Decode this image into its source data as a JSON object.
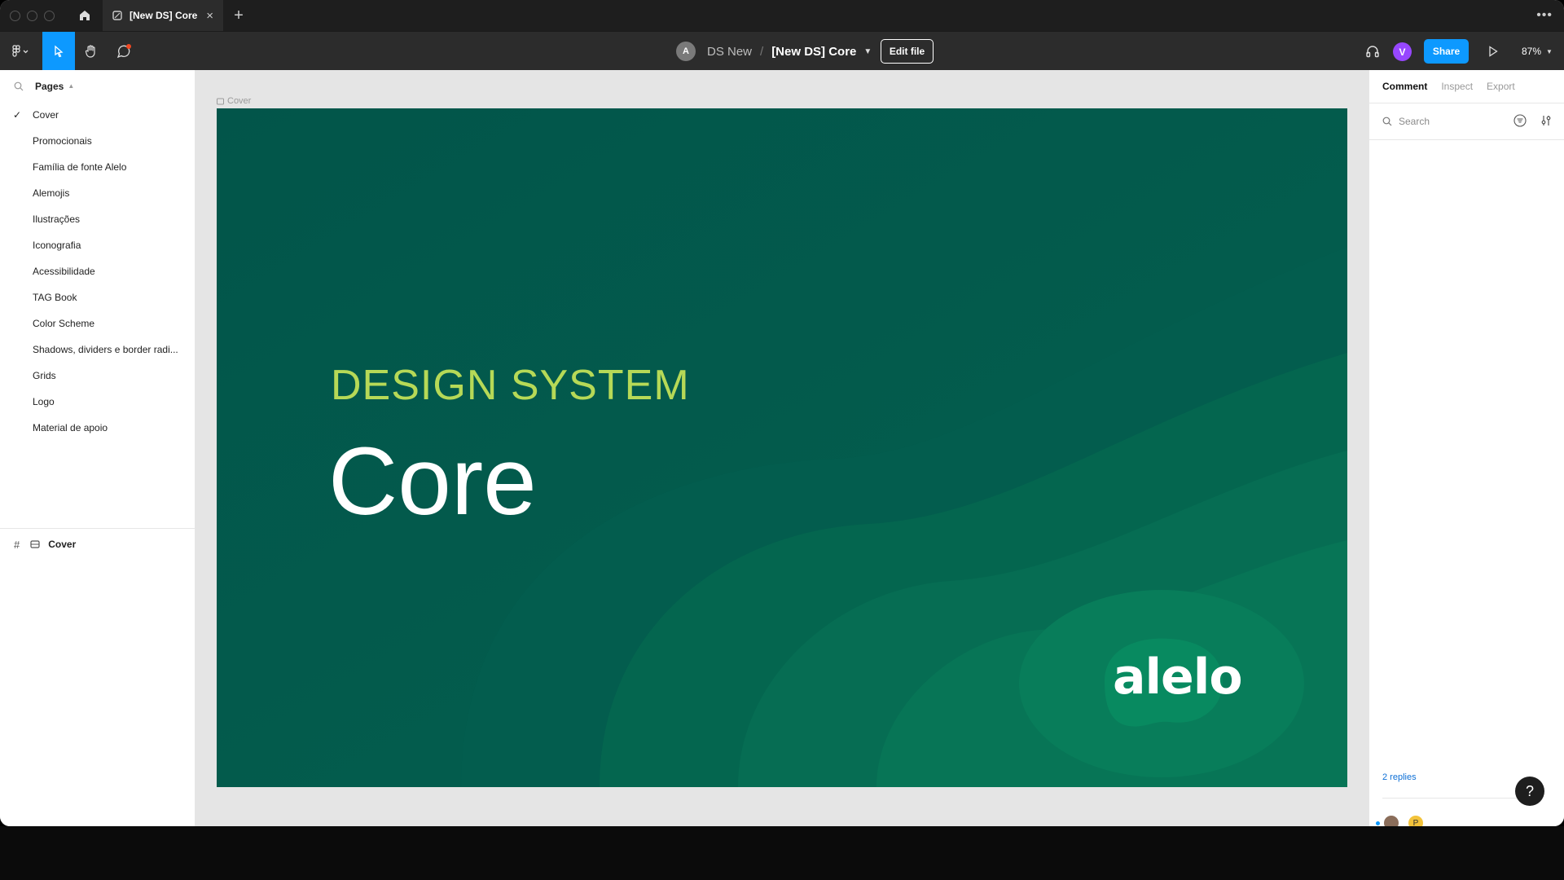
{
  "tabbar": {
    "tab_title": "[New DS] Core",
    "close_glyph": "×",
    "new_tab_glyph": "+",
    "more_glyph": "•••"
  },
  "toolbar": {
    "team_initial": "A",
    "project": "DS New",
    "separator": "/",
    "file_name": "[New DS] Core",
    "edit_label": "Edit file",
    "user_initial": "V",
    "share_label": "Share",
    "zoom": "87%"
  },
  "left": {
    "pages_title": "Pages",
    "pages": [
      "Cover",
      "Promocionais",
      "Família de fonte Alelo",
      "Alemojis",
      "Ilustrações",
      "Iconografia",
      "Acessibilidade",
      "TAG Book",
      "Color Scheme",
      "Shadows, dividers e border radi...",
      "Grids",
      "Logo",
      "Material de apoio"
    ],
    "selected_page": "Cover",
    "layer_name": "Cover"
  },
  "canvas": {
    "frame_label": "Cover",
    "subtitle": "DESIGN SYSTEM",
    "title": "Core",
    "logo_text": "alelo"
  },
  "right": {
    "tabs": [
      "Comment",
      "Inspect",
      "Export"
    ],
    "active_tab": "Comment",
    "search_placeholder": "Search",
    "replies": "2 replies",
    "avatar2_initial": "P"
  },
  "help_label": "?",
  "colors": {
    "accent": "#0d99ff",
    "frame_bg": "#03584d",
    "subtitle": "#b6d957",
    "avatar": "#9747ff"
  }
}
